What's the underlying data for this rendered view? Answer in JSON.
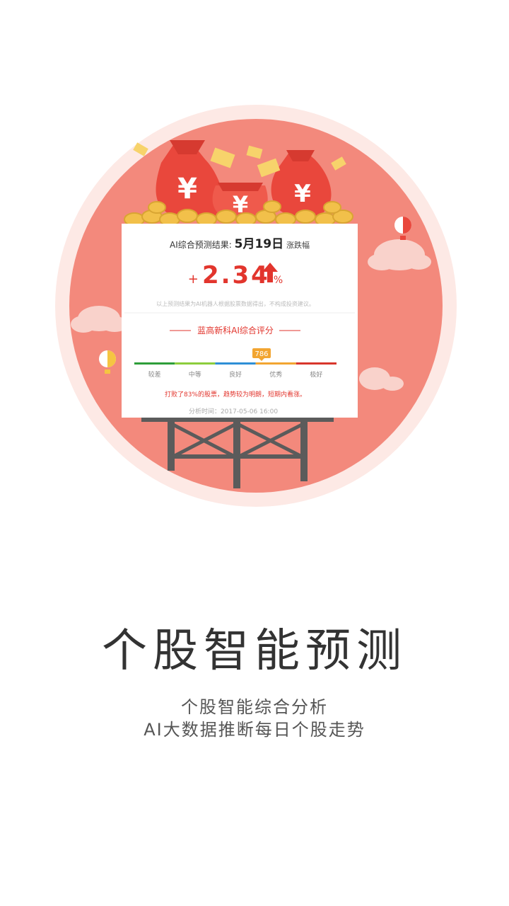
{
  "card": {
    "prediction_label": "AI综合预测结果:",
    "prediction_date": "5月19日",
    "prediction_suffix": "涨跌幅",
    "change_sign": "+",
    "change_value": "2.34",
    "change_unit": "%",
    "disclaimer": "以上预测结果为AI机器人根据股票数据得出，不构成投资建议。",
    "score_title": "蓝高新科AI综合评分",
    "score": "786",
    "score_levels": [
      "较差",
      "中等",
      "良好",
      "优秀",
      "极好"
    ],
    "score_level_colors": [
      "#2e9e3a",
      "#8ccd3c",
      "#2f8fd6",
      "#f2a531",
      "#d8362c"
    ],
    "summary": "打败了83%的股票，趋势较为明朗，短期内看涨。",
    "analysis_time": "分析时间：2017-05-06 16:00"
  },
  "headline": "个股智能预测",
  "subtitle_line1": "个股智能综合分析",
  "subtitle_line2": "AI大数据推断每日个股走势",
  "colors": {
    "circle_bg": "#f3897c",
    "circle_ring": "#fde7e3",
    "accent_red": "#e2352d"
  }
}
